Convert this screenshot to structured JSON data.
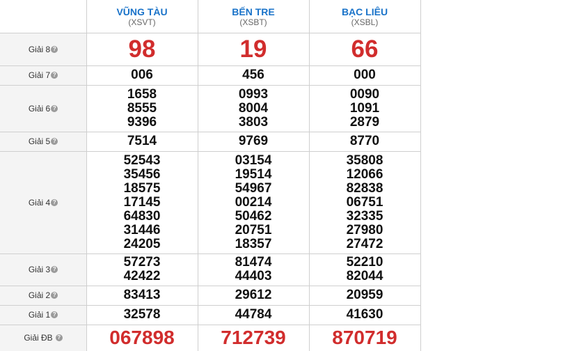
{
  "provinces": [
    {
      "name": "VŨNG TÀU",
      "code": "(XSVT)"
    },
    {
      "name": "BẾN TRE",
      "code": "(XSBT)"
    },
    {
      "name": "BẠC LIÊU",
      "code": "(XSBL)"
    }
  ],
  "prizes": [
    {
      "label": "Giải 8",
      "style": "big",
      "values": [
        [
          "98"
        ],
        [
          "19"
        ],
        [
          "66"
        ]
      ]
    },
    {
      "label": "Giải 7",
      "style": "normal",
      "values": [
        [
          "006"
        ],
        [
          "456"
        ],
        [
          "000"
        ]
      ]
    },
    {
      "label": "Giải 6",
      "style": "normal",
      "values": [
        [
          "1658",
          "8555",
          "9396"
        ],
        [
          "0993",
          "8004",
          "3803"
        ],
        [
          "0090",
          "1091",
          "2879"
        ]
      ]
    },
    {
      "label": "Giải 5",
      "style": "normal",
      "values": [
        [
          "7514"
        ],
        [
          "9769"
        ],
        [
          "8770"
        ]
      ]
    },
    {
      "label": "Giải 4",
      "style": "normal",
      "values": [
        [
          "52543",
          "35456",
          "18575",
          "17145",
          "64830",
          "31446",
          "24205"
        ],
        [
          "03154",
          "19514",
          "54967",
          "00214",
          "50462",
          "20751",
          "18357"
        ],
        [
          "35808",
          "12066",
          "82838",
          "06751",
          "32335",
          "27980",
          "27472"
        ]
      ]
    },
    {
      "label": "Giải 3",
      "style": "normal",
      "values": [
        [
          "57273",
          "42422"
        ],
        [
          "81474",
          "44403"
        ],
        [
          "52210",
          "82044"
        ]
      ]
    },
    {
      "label": "Giải 2",
      "style": "normal",
      "values": [
        [
          "83413"
        ],
        [
          "29612"
        ],
        [
          "20959"
        ]
      ]
    },
    {
      "label": "Giải 1",
      "style": "normal",
      "values": [
        [
          "32578"
        ],
        [
          "44784"
        ],
        [
          "41630"
        ]
      ]
    },
    {
      "label": "Giải ĐB",
      "style": "special",
      "values": [
        [
          "067898"
        ],
        [
          "712739"
        ],
        [
          "870719"
        ]
      ]
    }
  ],
  "help_icon": "question-circle-icon",
  "colors": {
    "province_name": "#1a73c9",
    "highlight_number": "#d12d2d",
    "grid_line": "#cfcfcf",
    "label_background": "#f4f4f4"
  }
}
